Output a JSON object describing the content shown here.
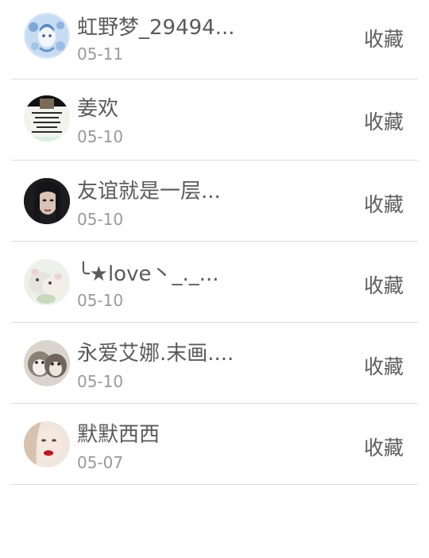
{
  "favorites": {
    "items": [
      {
        "name": "虹野梦_29494...",
        "date": "05-11",
        "action": "收藏",
        "avatar": "avatar-blue-anime"
      },
      {
        "name": "姜欢",
        "date": "05-10",
        "action": "收藏",
        "avatar": "avatar-text-card"
      },
      {
        "name": "友谊就是一层...",
        "date": "05-10",
        "action": "收藏",
        "avatar": "avatar-dark-portrait"
      },
      {
        "name": "╰★love丶_._...",
        "date": "05-10",
        "action": "收藏",
        "avatar": "avatar-hamster"
      },
      {
        "name": "永爱艾娜.末画....",
        "date": "05-10",
        "action": "收藏",
        "avatar": "avatar-puppies"
      },
      {
        "name": "默默西西",
        "date": "05-07",
        "action": "收藏",
        "avatar": "avatar-red-lips"
      }
    ]
  },
  "colors": {
    "name_text": "#5a5a5a",
    "date_text": "#9a9a9a",
    "divider": "#dcdcdc",
    "background": "#ffffff"
  }
}
